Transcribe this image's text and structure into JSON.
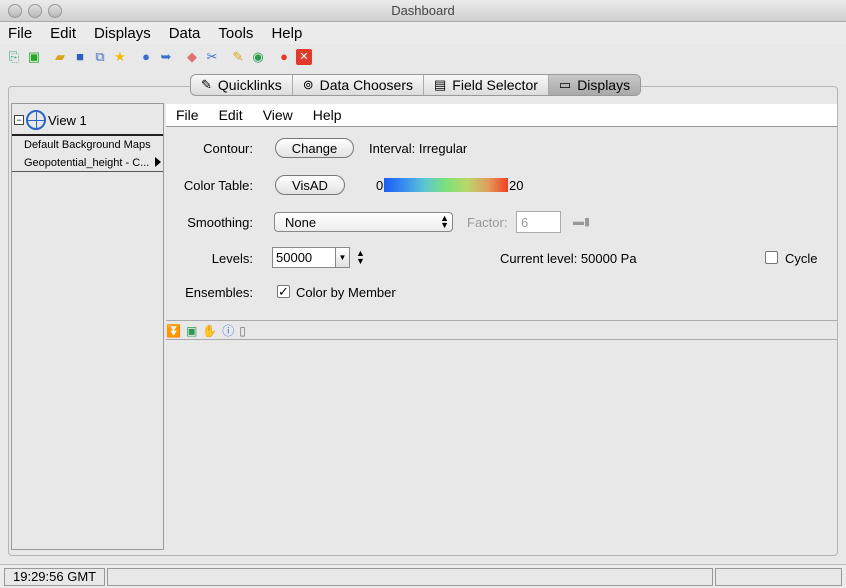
{
  "window": {
    "title": "Dashboard"
  },
  "menubar": {
    "file": "File",
    "edit": "Edit",
    "displays": "Displays",
    "data": "Data",
    "tools": "Tools",
    "help": "Help"
  },
  "toolbar": {
    "icons": [
      "new-window-icon",
      "new-display-icon",
      "open-icon",
      "save-icon",
      "copy-icon",
      "favorite-icon",
      "help-icon",
      "forward-icon",
      "eraser-icon",
      "cut-icon",
      "edit-pencil-icon",
      "globe-icon",
      "record-icon",
      "close-icon"
    ]
  },
  "tabs": [
    {
      "label": "Quicklinks",
      "icon": "quicklinks-icon"
    },
    {
      "label": "Data Choosers",
      "icon": "binoculars-icon"
    },
    {
      "label": "Field Selector",
      "icon": "clipboard-icon"
    },
    {
      "label": "Displays",
      "icon": "monitor-icon"
    }
  ],
  "left": {
    "view_label": "View 1",
    "expander": "⊟",
    "layers": [
      "Default Background Maps",
      "Geopotential_height - C..."
    ]
  },
  "submenu": {
    "file": "File",
    "edit": "Edit",
    "view": "View",
    "help": "Help"
  },
  "controls": {
    "contour_label": "Contour:",
    "contour_button": "Change",
    "contour_interval": "Interval: Irregular",
    "colortable_label": "Color Table:",
    "colortable_button": "VisAD",
    "colortable_min": "0",
    "colortable_max": "20",
    "smoothing_label": "Smoothing:",
    "smoothing_value": "None",
    "factor_label": "Factor:",
    "factor_value": "6",
    "levels_label": "Levels:",
    "levels_value": "50000",
    "current_level": "Current level: 50000 Pa",
    "cycle_label": "Cycle",
    "ensembles_label": "Ensembles:",
    "color_by_member": "Color by Member",
    "color_by_member_checked": true,
    "cycle_checked": false
  },
  "status": {
    "time": "19:29:56 GMT"
  }
}
